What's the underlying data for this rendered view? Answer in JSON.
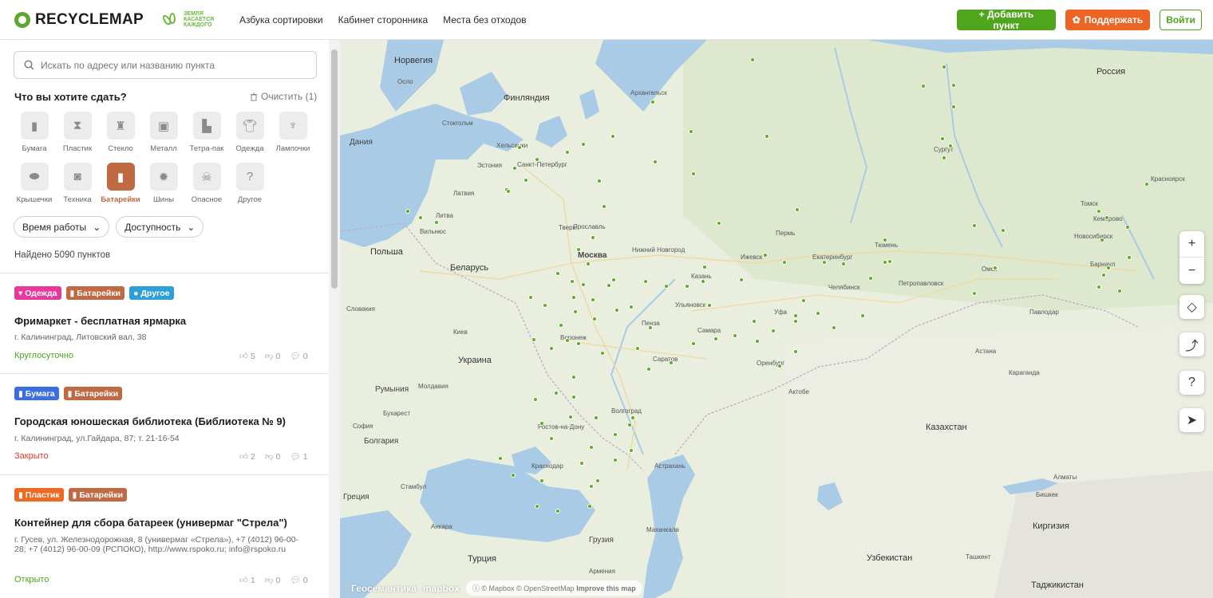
{
  "header": {
    "logo": "RECYCLEMAP",
    "partner": "ЗЕМЛЯ КАСАЕТСЯ КАЖДОГО",
    "nav": [
      "Азбука сортировки",
      "Кабинет сторонника",
      "Места без отходов"
    ],
    "add_button": "+ Добавить пункт",
    "support_button": "Поддержать",
    "login_button": "Войти"
  },
  "sidebar": {
    "search_placeholder": "Искать по адресу или названию пункта",
    "question": "Что вы хотите сдать?",
    "clear": "Очистить (1)",
    "categories": [
      {
        "label": "Бумага",
        "icon": "paper-icon",
        "active": false
      },
      {
        "label": "Пластик",
        "icon": "plastic-bottle-icon",
        "active": false
      },
      {
        "label": "Стекло",
        "icon": "glass-bottle-icon",
        "active": false
      },
      {
        "label": "Металл",
        "icon": "metal-can-icon",
        "active": false
      },
      {
        "label": "Тетра-пак",
        "icon": "tetra-pak-icon",
        "active": false
      },
      {
        "label": "Одежда",
        "icon": "clothes-icon",
        "active": false
      },
      {
        "label": "Лампочки",
        "icon": "bulb-icon",
        "active": false
      },
      {
        "label": "Крышечки",
        "icon": "caps-icon",
        "active": false
      },
      {
        "label": "Техника",
        "icon": "appliance-icon",
        "active": false
      },
      {
        "label": "Батарейки",
        "icon": "battery-icon",
        "active": true
      },
      {
        "label": "Шины",
        "icon": "tire-icon",
        "active": false
      },
      {
        "label": "Опасное",
        "icon": "hazard-icon",
        "active": false
      },
      {
        "label": "Другое",
        "icon": "question-icon",
        "active": false
      }
    ],
    "filters": [
      "Время работы",
      "Доступность"
    ],
    "found": "Найдено 5090 пунктов",
    "cards": [
      {
        "tags": [
          "Одежда",
          "Батарейки",
          "Другое"
        ],
        "title": "Фримаркет - бесплатная ярмарка",
        "address": "г. Калининград, Литовский вал, 38",
        "status": "Круглосуточно",
        "likes": "5",
        "dislikes": "0",
        "comments": "0"
      },
      {
        "tags": [
          "Бумага",
          "Батарейки"
        ],
        "title": "Городская юношеская библиотека (Библиотека № 9)",
        "address": "г. Калининград, ул.Гайдара, 87; т. 21-16-54",
        "status": "Закрыто",
        "likes": "2",
        "dislikes": "0",
        "comments": "1"
      },
      {
        "tags": [
          "Пластик",
          "Батарейки"
        ],
        "title": "Контейнер для сбора батареек (универмаг \"Стрела\")",
        "address": "г. Гусев, ул. Железнодорожная, 8 (универмаг «Стрела»), +7 (4012) 96-00-28; +7 (4012) 96-00-09 (РСПОКО), http://www.rspoko.ru; info@rspoko.ru",
        "status": "Открыто",
        "likes": "1",
        "dislikes": "0",
        "comments": "0"
      }
    ]
  },
  "map": {
    "labels": {
      "norway": "Норвегия",
      "finland": "Финляндия",
      "russia": "Россия",
      "denmark": "Дания",
      "estonia": "Эстония",
      "latvia": "Латвия",
      "lithuania": "Литва",
      "poland": "Польша",
      "belarus": "Беларусь",
      "ukraine": "Украина",
      "slovakia": "Словакия",
      "romania": "Румыния",
      "moldova": "Молдавия",
      "bulgaria": "Болгария",
      "greece": "Греция",
      "turkey": "Турция",
      "kazakhstan": "Казахстан",
      "kyrgyzstan": "Киргизия",
      "uzbekistan": "Узбекистан",
      "turkmenistan": "Таджикистан",
      "georgia": "Грузия",
      "armenia": "Армения",
      "moscow": "Москва",
      "spb": "Санкт-Петербург",
      "helsinki": "Хельсинки",
      "stockholm": "Стокгольм",
      "oslo": "Осло",
      "kazan": "Казань",
      "perm": "Пермь",
      "ekb": "Екатеринбург",
      "ufa": "Уфа",
      "samara": "Самара",
      "saratov": "Саратов",
      "volgograd": "Волгоград",
      "rostov": "Ростов-на-Дону",
      "voronezh": "Воронеж",
      "kiev": "Киев",
      "chelyabinsk": "Челябинск",
      "omsk": "Омск",
      "novosibirsk": "Новосибирск",
      "tomsk": "Томск",
      "kemerovo": "Кемерово",
      "barnaul": "Барнаул",
      "krasnoyarsk": "Красноярск",
      "astana": "Астана",
      "karaganda": "Караганда",
      "almaty": "Алматы",
      "bishkek": "Бишкек",
      "tashkent": "Ташкент",
      "aktobe": "Актобе",
      "orenburg": "Оренбург",
      "astrakhan": "Астрахань",
      "krasnodar": "Краснодар",
      "istanbul": "Стамбул",
      "ankara": "Анкара",
      "tyumen": "Тюмень",
      "surgut": "Сургут",
      "nn": "Нижний Новгород",
      "yaroslavl": "Ярославль",
      "tver": "Тверь",
      "izhevsk": "Ижевск",
      "ulyanovsk": "Ульяновск",
      "penza": "Пенза",
      "petropavlovsk": "Петропавловск",
      "pavlodar": "Павлодар",
      "arkhangelsk": "Архангельск",
      "vilnius": "Вильнюс",
      "sofia": "София",
      "bucharest": "Бухарест",
      "makhachkala": "Махачкала"
    },
    "attribution": "© Mapbox © OpenStreetMap",
    "improve": "Improve this map",
    "brand1": "Геосемантика",
    "brand2": "mapbox"
  }
}
